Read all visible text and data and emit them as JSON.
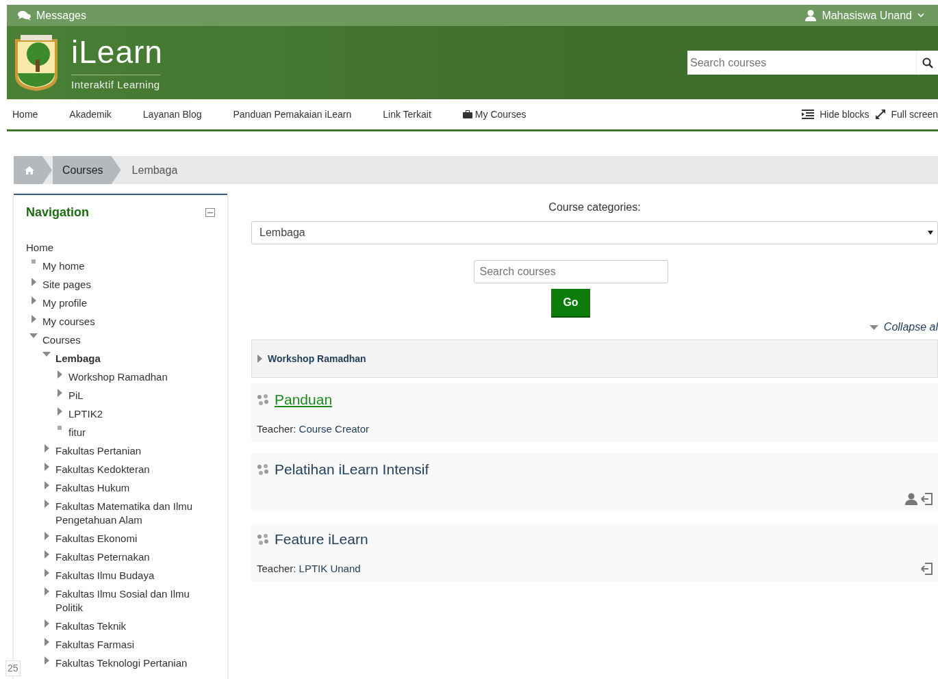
{
  "top_bar": {
    "messages": "Messages",
    "user": "Mahasiswa Unand"
  },
  "header": {
    "logo_title": "iLearn",
    "logo_subtitle": "Interaktif Learning",
    "search": {
      "placeholder": "Search courses"
    }
  },
  "menu": {
    "items": [
      {
        "label": "Home",
        "kind": "text"
      },
      {
        "label": "Akademik",
        "kind": "text"
      },
      {
        "label": "Layanan Blog",
        "kind": "text"
      },
      {
        "label": "Panduan Pemakaian iLearn",
        "kind": "text"
      },
      {
        "label": "Link Terkait",
        "kind": "text"
      },
      {
        "label": "My Courses",
        "kind": "briefcase"
      }
    ],
    "right": [
      {
        "label": "Hide blocks",
        "kind": "blocks"
      },
      {
        "label": "Full screen",
        "kind": "expand"
      }
    ]
  },
  "breadcrumb": [
    {
      "label": "Courses",
      "kind": "link"
    },
    {
      "label": "Lembaga",
      "kind": "current"
    }
  ],
  "navigation": {
    "title": "Navigation",
    "home": "Home",
    "items": [
      {
        "label": "My home",
        "kind": "leaf",
        "selected": false
      },
      {
        "label": "Site pages",
        "kind": "branch",
        "expanded": false,
        "selected": false
      },
      {
        "label": "My profile",
        "kind": "branch",
        "expanded": false,
        "selected": false
      },
      {
        "label": "My courses",
        "kind": "branch",
        "expanded": false,
        "selected": false
      },
      {
        "label": "Courses",
        "kind": "branch",
        "expanded": true,
        "selected": false,
        "children": [
          {
            "label": "Lembaga",
            "kind": "branch",
            "expanded": true,
            "selected": true,
            "children": [
              {
                "label": "Workshop Ramadhan",
                "kind": "branch",
                "expanded": false,
                "selected": false
              },
              {
                "label": "PiL",
                "kind": "branch",
                "expanded": false,
                "selected": false
              },
              {
                "label": "LPTIK2",
                "kind": "branch",
                "expanded": false,
                "selected": false
              },
              {
                "label": "fitur",
                "kind": "leaf",
                "selected": false
              }
            ]
          },
          {
            "label": "Fakultas Pertanian",
            "kind": "branch",
            "expanded": false,
            "selected": false
          },
          {
            "label": "Fakultas Kedokteran",
            "kind": "branch",
            "expanded": false,
            "selected": false
          },
          {
            "label": "Fakultas Hukum",
            "kind": "branch",
            "expanded": false,
            "selected": false
          },
          {
            "label": "Fakultas Matematika dan Ilmu Pengetahuan Alam",
            "kind": "branch",
            "expanded": false,
            "selected": false
          },
          {
            "label": "Fakultas Ekonomi",
            "kind": "branch",
            "expanded": false,
            "selected": false
          },
          {
            "label": "Fakultas Peternakan",
            "kind": "branch",
            "expanded": false,
            "selected": false
          },
          {
            "label": "Fakultas Ilmu Budaya",
            "kind": "branch",
            "expanded": false,
            "selected": false
          },
          {
            "label": "Fakultas Ilmu Sosial dan Ilmu Politik",
            "kind": "branch",
            "expanded": false,
            "selected": false
          },
          {
            "label": "Fakultas Teknik",
            "kind": "branch",
            "expanded": false,
            "selected": false
          },
          {
            "label": "Fakultas Farmasi",
            "kind": "branch",
            "expanded": false,
            "selected": false
          },
          {
            "label": "Fakultas Teknologi Pertanian",
            "kind": "branch",
            "expanded": false,
            "selected": false
          }
        ]
      }
    ]
  },
  "main": {
    "categories_label": "Course categories:",
    "category_select": "Lembaga",
    "search": {
      "placeholder": "Search courses"
    },
    "go_button": "Go",
    "collapse_all": "Collapse al",
    "subcategory": {
      "label": "Workshop Ramadhan",
      "expanded": false
    },
    "courses": [
      {
        "name": "Panduan",
        "hovered": true,
        "teacher_label": "Teacher:",
        "teacher": "Course Creator",
        "guest_access": false,
        "self_enrol": false
      },
      {
        "name": "Pelatihan iLearn Intensif",
        "hovered": false,
        "guest_access": true,
        "self_enrol": true
      },
      {
        "name": "Feature iLearn",
        "hovered": false,
        "teacher_label": "Teacher:",
        "teacher": "LPTIK Unand",
        "guest_access": false,
        "self_enrol": true
      }
    ]
  },
  "edge_fragment": "25"
}
